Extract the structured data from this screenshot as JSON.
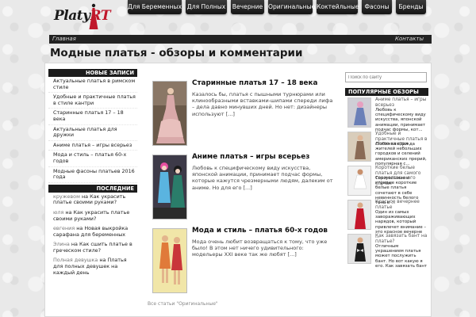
{
  "logo": {
    "text_main": "Platy",
    "text_accent": "RT"
  },
  "nav": {
    "items": [
      {
        "label": "Для Беременных"
      },
      {
        "label": "Для Полных"
      },
      {
        "label": "Вечерние"
      },
      {
        "label": "Оригинальные"
      },
      {
        "label": "Коктейльные"
      },
      {
        "label": "Фасоны"
      },
      {
        "label": "Бренды"
      }
    ]
  },
  "breadcrumb": {
    "home": "Главная",
    "contacts": "Контакты"
  },
  "page_title": "Модные платья - обзоры и комментарии",
  "left_sidebar": {
    "recent_heading": "НОВЫЕ ЗАПИСИ",
    "recent_posts": [
      "Актуальные платья в римском стиле",
      "Удобные и практичные платья в стиле кантри",
      "Старинные платья 17 – 18 века",
      "Актуальные платья для дружки",
      "Аниме платья – игры всерьез",
      "Мода и стиль – платья 60-х годов",
      "Модные фасоны платьев 2016 года"
    ],
    "comments_heading": "ПОСЛЕДНИЕ КОММЕНТАРИИ",
    "comments": [
      {
        "author": "кружевом",
        "on": "на",
        "post": "Как украсить платье своими руками?"
      },
      {
        "author": "юля",
        "on": "на",
        "post": "Как украсить платье своими руками?"
      },
      {
        "author": "евгения",
        "on": "на",
        "post": "Новая выкройка сарафана для беременных"
      },
      {
        "author": "Элина",
        "on": "на",
        "post": "Как сшить платье в греческом стиле?"
      },
      {
        "author": "Полная девушка",
        "on": "на",
        "post": "Платья для полных девушек на каждый день"
      }
    ]
  },
  "posts": [
    {
      "title": "Старинные платья 17 – 18 века",
      "excerpt": "Казалось бы, платья с пышными турнюрами или клинообразными вставками-шипами спереди лифа – дела давно минувших дней. Но нет: дизайнеры используют [...]"
    },
    {
      "title": "Аниме платья – игры всерьез",
      "excerpt": "Любовь к специфическому виду искусства, японской анимации, принимает подчас формы, которые кажутся чрезмерными людям, далеким от аниме. Но для его [...]"
    },
    {
      "title": "Мода и стиль – платья 60-х годов",
      "excerpt": "Мода очень любит возвращаться к тому, что уже было! В этом нет ничего удивительного: модельеры XXI веке так же любят [...]"
    }
  ],
  "all_posts_link": "Все статьи \"Оригинальные\"",
  "search": {
    "placeholder": "Поиск по сайту"
  },
  "right_sidebar": {
    "heading": "ПОПУЛЯРНЫЕ ОБЗОРЫ",
    "items": [
      {
        "title": "Аниме платья – игры всерьез",
        "excerpt": "Любовь к специфическому виду искусства, японской анимации, принимает подчас формы, кот..."
      },
      {
        "title": "Удобные и практичные платья в стиле кантри",
        "excerpt": "Любимая одежда жителей небольших городков и селений американских прерий, популярная с..."
      },
      {
        "title": "Короткие белые платья для самого торжественного случая",
        "excerpt": "Сексуальные и игривые короткие белые платья сочетают в себе невинность белого тона и ..."
      },
      {
        "title": "Красное вечернее платье",
        "excerpt": "Один из самых завораживающих нарядов, который привлечет внимание – это красное вечерне ..."
      },
      {
        "title": "Как завязать бант на платье?",
        "excerpt": "Отличным украшением платья может послужить бант. Но вот какую я его. Как завязать бант"
      }
    ]
  }
}
